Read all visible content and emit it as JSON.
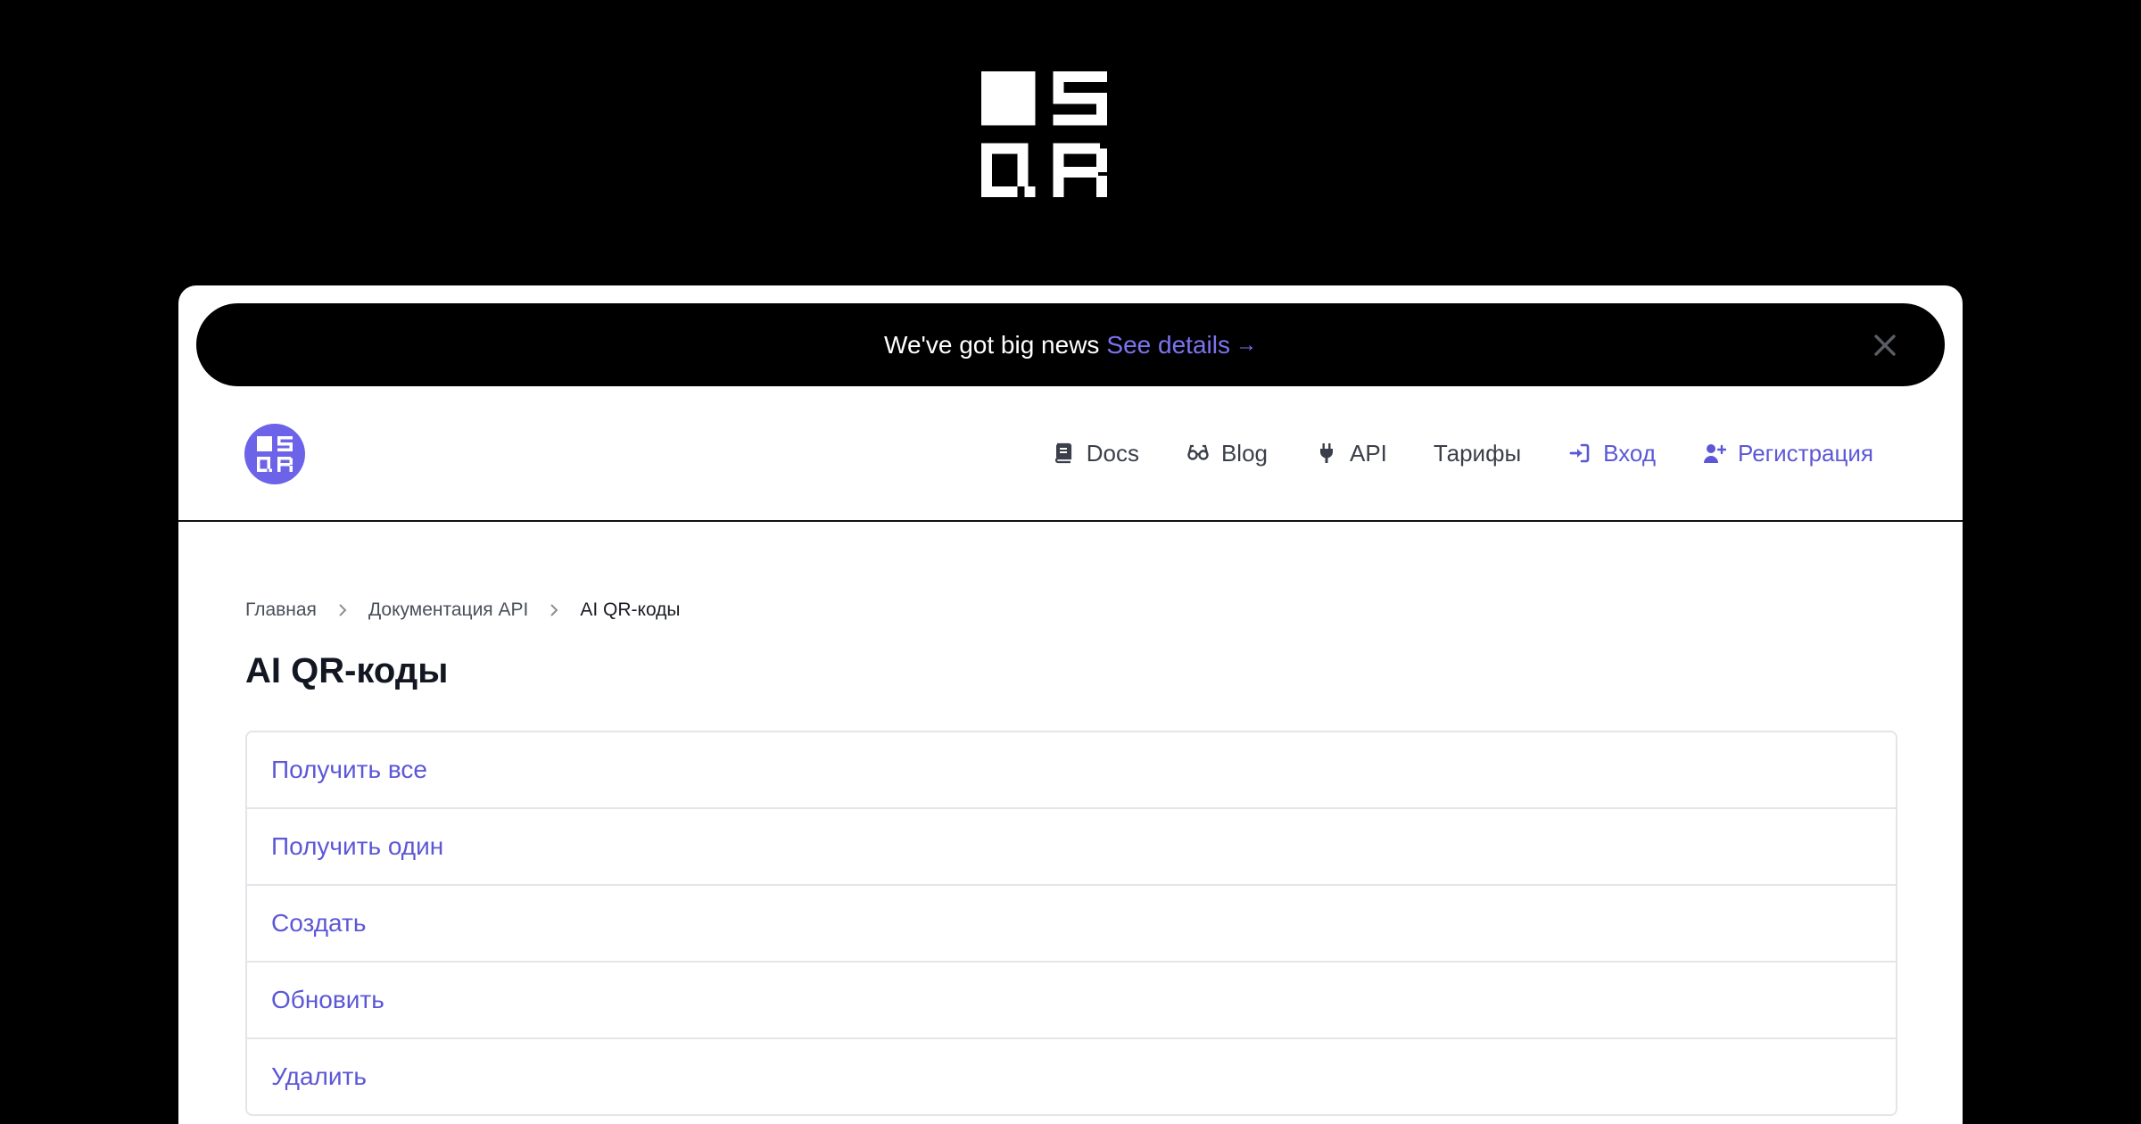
{
  "colors": {
    "accent": "#5c57d6",
    "accent_light": "#7b74f0",
    "logo_circle": "#6c63e8",
    "background": "#000000",
    "card": "#ffffff",
    "border": "#e3e5e9"
  },
  "top_logo": {
    "icon": "sqr-logo-icon",
    "letters": "SQR"
  },
  "banner": {
    "text": "We've got big news",
    "link_label": "See details",
    "arrow": "→",
    "close_icon": "close-icon"
  },
  "navbar": {
    "logo_icon": "sqr-logo-icon",
    "items": [
      {
        "label": "Docs",
        "icon": "book-icon"
      },
      {
        "label": "Blog",
        "icon": "glasses-icon"
      },
      {
        "label": "API",
        "icon": "plug-icon"
      },
      {
        "label": "Тарифы",
        "icon": ""
      },
      {
        "label": "Вход",
        "icon": "sign-in-icon"
      },
      {
        "label": "Регистрация",
        "icon": "user-plus-icon"
      }
    ]
  },
  "breadcrumb": {
    "items": [
      "Главная",
      "Документация API",
      "AI QR-коды"
    ],
    "separator_icon": "chevron-right-icon"
  },
  "page": {
    "title": "AI QR-коды"
  },
  "endpoints": [
    "Получить все",
    "Получить один",
    "Создать",
    "Обновить",
    "Удалить"
  ]
}
